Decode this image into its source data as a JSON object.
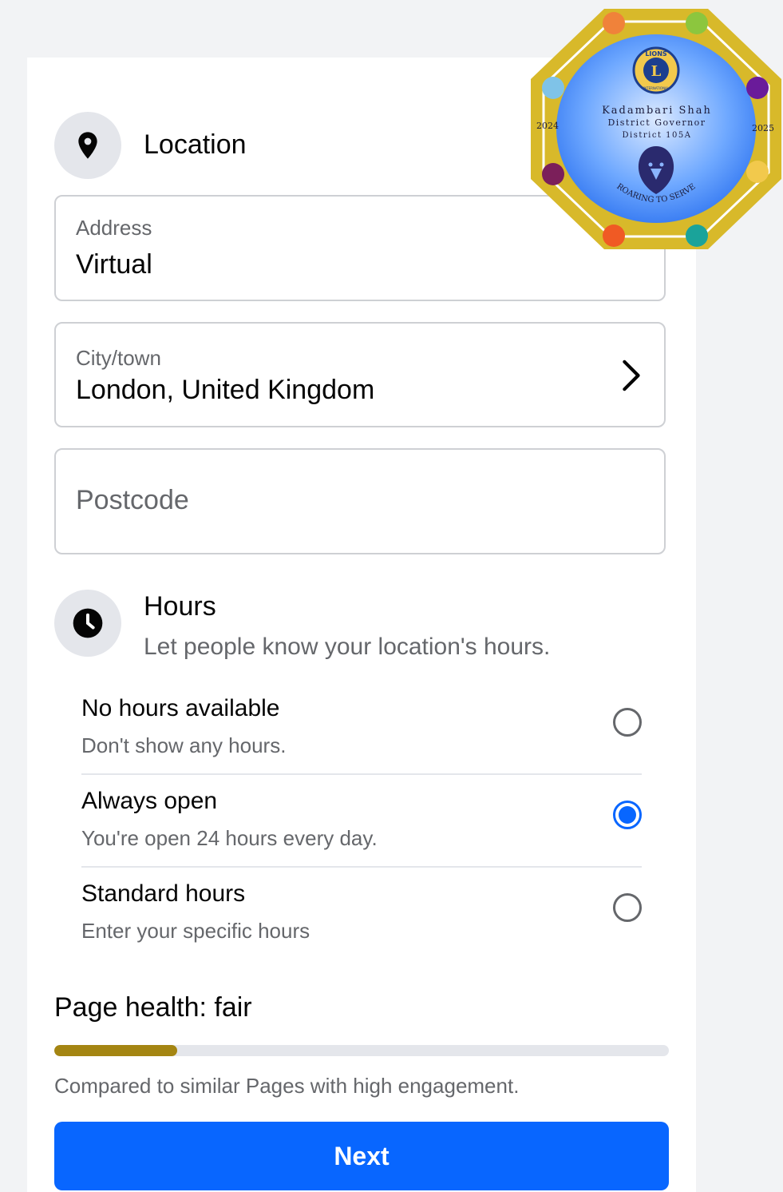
{
  "location": {
    "title": "Location",
    "icon": "location-pin-icon",
    "address": {
      "label": "Address",
      "value": "Virtual"
    },
    "city": {
      "label": "City/town",
      "value": "London, United Kingdom"
    },
    "postcode": {
      "placeholder": "Postcode",
      "value": ""
    }
  },
  "hours": {
    "title": "Hours",
    "subtitle": "Let people know your location's hours.",
    "icon": "clock-icon",
    "options": [
      {
        "title": "No hours available",
        "subtitle": "Don't show any hours.",
        "selected": false
      },
      {
        "title": "Always open",
        "subtitle": "You're open 24 hours every day.",
        "selected": true
      },
      {
        "title": "Standard hours",
        "subtitle": "Enter your specific hours",
        "selected": false
      }
    ]
  },
  "page_health": {
    "label": "Page health:",
    "status": "fair",
    "level": 0.2,
    "note": "Compared to similar Pages with high engagement.",
    "fill_color": "#a48512"
  },
  "next_button": {
    "label": "Next",
    "color": "#0866ff"
  },
  "badge": {
    "name": "Kadambari Shah",
    "role": "District Governor",
    "district": "District 105A",
    "year_left": "2024",
    "year_right": "2025",
    "motto": "ROARING TO SERVE",
    "logo_text": "LIONS",
    "logo_subtext": "INTERNATIONAL"
  }
}
